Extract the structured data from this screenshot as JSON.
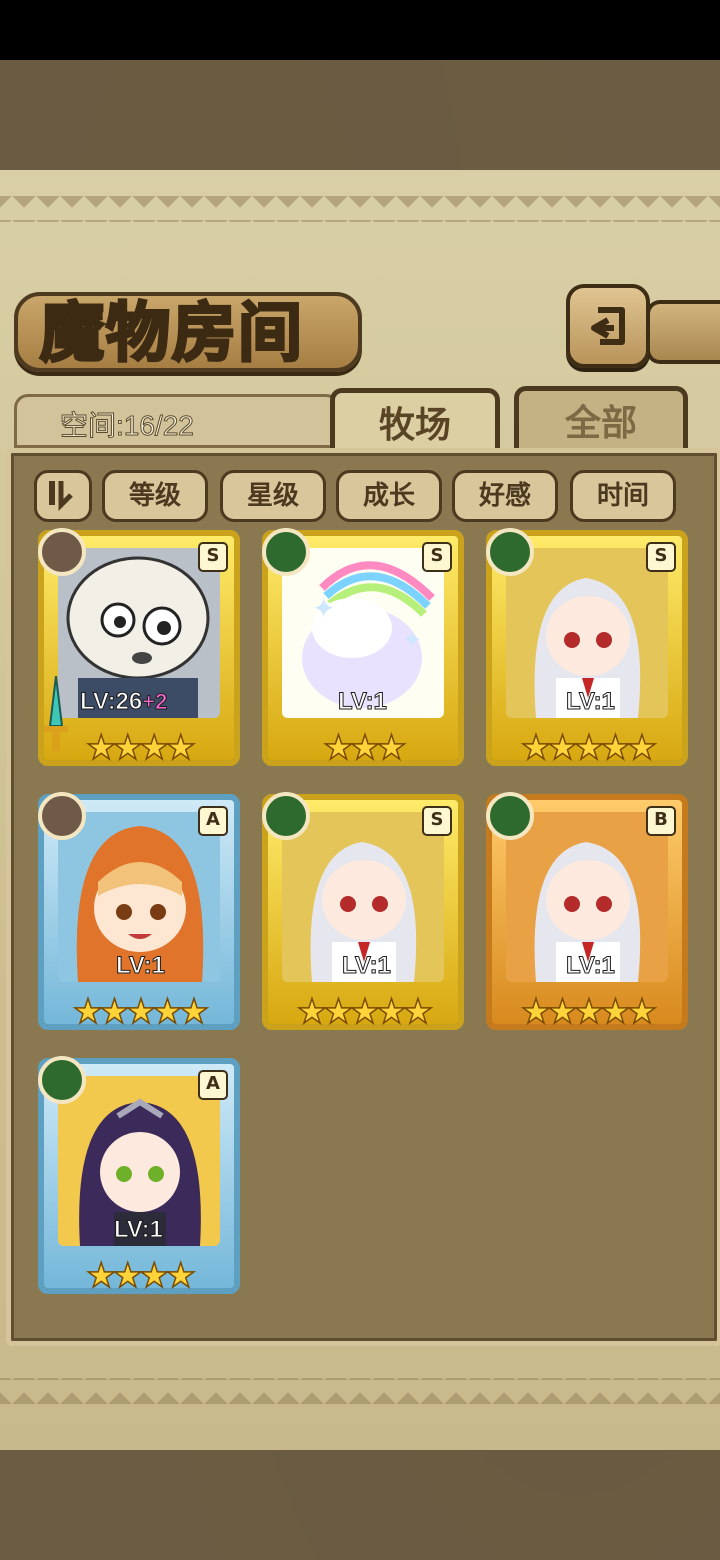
{
  "header": {
    "title": "魔物房间",
    "back_icon": "back-arrow-icon"
  },
  "space": {
    "label": "空间:16/22"
  },
  "tabs": [
    {
      "label": "牧场",
      "active": true
    },
    {
      "label": "全部",
      "active": false
    }
  ],
  "sort": {
    "toggle_icon": "sort-order-icon",
    "options": [
      "等级",
      "星级",
      "成长",
      "好感",
      "时间"
    ]
  },
  "monsters": [
    {
      "rank": "S",
      "element": "earth",
      "level": "LV:26",
      "bonus": "+2",
      "stars": 4,
      "frame": "gold",
      "weapon": true
    },
    {
      "rank": "S",
      "element": "nature",
      "level": "LV:1",
      "bonus": "",
      "stars": 3,
      "frame": "gold",
      "weapon": false
    },
    {
      "rank": "S",
      "element": "nature",
      "level": "LV:1",
      "bonus": "",
      "stars": 5,
      "frame": "gold",
      "weapon": false
    },
    {
      "rank": "A",
      "element": "earth",
      "level": "LV:1",
      "bonus": "",
      "stars": 5,
      "frame": "blue",
      "weapon": false
    },
    {
      "rank": "S",
      "element": "nature",
      "level": "LV:1",
      "bonus": "",
      "stars": 5,
      "frame": "gold",
      "weapon": false
    },
    {
      "rank": "B",
      "element": "nature",
      "level": "LV:1",
      "bonus": "",
      "stars": 5,
      "frame": "orange",
      "weapon": false
    },
    {
      "rank": "A",
      "element": "nature",
      "level": "LV:1",
      "bonus": "",
      "stars": 4,
      "frame": "blue",
      "weapon": false
    }
  ]
}
